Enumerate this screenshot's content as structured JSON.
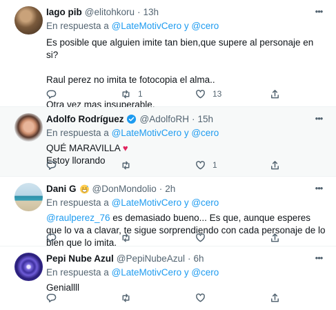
{
  "tweets": [
    {
      "name": "Iago pib",
      "handle": "@elitohkoru",
      "time": "13h",
      "reply_prefix": "En respuesta a",
      "reply_to": "@LateMotivCero y @cero",
      "lines": [
        "Es posible que alguien imite tan bien,que supere al personaje en si?",
        "",
        "Raul perez no imita te fotocopia el alma..",
        "",
        "Otra vez mas insuperable."
      ],
      "replies": "",
      "retweets": "1",
      "likes": "13",
      "highlighted": false
    },
    {
      "name": "Adolfo Rodríguez",
      "verified": true,
      "handle": "@AdolfoRH",
      "time": "15h",
      "reply_prefix": "En respuesta a",
      "reply_to": "@LateMotivCero y @cero",
      "text_line1": "QUÉ MARAVILLA",
      "text_line1_emoji": "♥",
      "text_line2": "Estoy llorando",
      "replies": "",
      "retweets": "",
      "likes": "1",
      "highlighted": true
    },
    {
      "name": "Dani G",
      "badge_icon": "grinning-sweat-emoji",
      "handle": "@DonMondolio",
      "time": "2h",
      "reply_prefix": "En respuesta a",
      "reply_to": "@LateMotivCero y @cero",
      "mention": "@raulperez_76",
      "text_rest": " es demasiado bueno... Es que, aunque esperes que lo va a clavar, te sigue sorprendiendo con cada personaje de lo bien que lo imita.",
      "replies": "",
      "retweets": "",
      "likes": "",
      "highlighted": false
    },
    {
      "name": "Pepi Nube Azul",
      "handle": "@PepiNubeAzul",
      "time": "6h",
      "reply_prefix": "En respuesta a",
      "reply_to": "@LateMotivCero y @cero",
      "text": "Geniallll",
      "replies": "",
      "retweets": "",
      "likes": "",
      "highlighted": false
    }
  ],
  "separator": "·",
  "more_glyph": "•••",
  "colors": {
    "link": "#1d9bf0",
    "secondary_text": "#536471",
    "heart": "#e0245e",
    "highlight_bg": "#f7f9f9"
  }
}
